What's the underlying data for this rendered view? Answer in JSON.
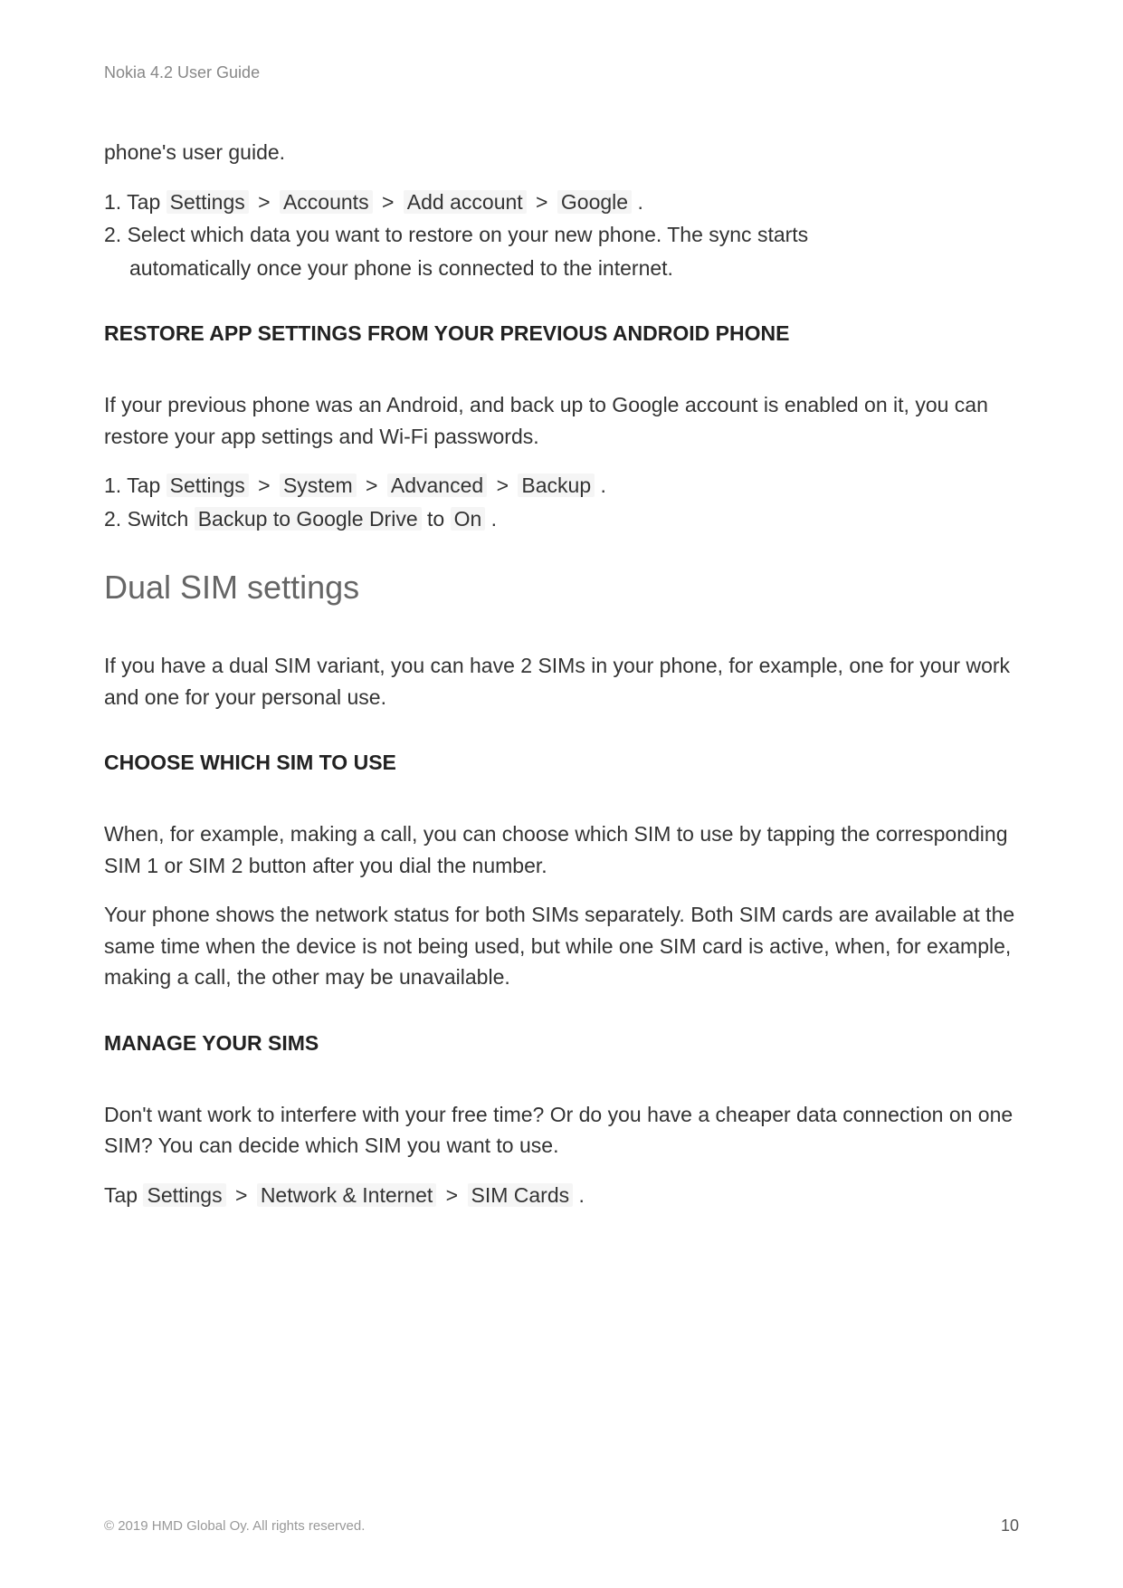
{
  "header": {
    "title": "Nokia 4.2 User Guide"
  },
  "intro": {
    "text": "phone's user guide."
  },
  "list1": {
    "item1_prefix": "1. Tap ",
    "item1_settings": "Settings",
    "item1_accounts": "Accounts",
    "item1_add_account": "Add account",
    "item1_google": "Google",
    "item1_suffix": " .",
    "item2_a": "2. Select which data you want to restore on your new phone. The sync starts",
    "item2_b": "automatically once your phone is connected to the internet."
  },
  "heading1": "RESTORE APP SETTINGS FROM YOUR PREVIOUS ANDROID PHONE",
  "para1": "If your previous phone was an Android, and back up to Google account is enabled on it, you can restore your app settings and Wi-Fi passwords.",
  "list2": {
    "item1_prefix": "1. Tap ",
    "item1_settings": "Settings",
    "item1_system": "System",
    "item1_advanced": "Advanced",
    "item1_backup": "Backup",
    "item1_suffix": " .",
    "item2_prefix": "2. Switch ",
    "item2_backup_drive": "Backup to Google Drive",
    "item2_to": " to ",
    "item2_on": "On",
    "item2_suffix": " ."
  },
  "heading2": "Dual SIM settings",
  "para2": "If you have a dual SIM variant, you can have 2 SIMs in your phone, for example, one for your work and one for your personal use.",
  "heading3": "CHOOSE WHICH SIM TO USE",
  "para3": "When, for example, making a call, you can choose which SIM to use by tapping the corresponding SIM 1 or SIM 2 button after you dial the number.",
  "para4": "Your phone shows the network status for both SIMs separately. Both SIM cards are available at the same time when the device is not being used, but while one SIM card is active, when, for example, making a call, the other may be unavailable.",
  "heading4": "MANAGE YOUR SIMS",
  "para5": "Don't want work to interfere with your free time? Or do you have a cheaper data connection on one SIM? You can decide which SIM you want to use.",
  "para6": {
    "prefix": "Tap ",
    "settings": "Settings",
    "network": "Network & Internet",
    "sim_cards": "SIM Cards",
    "suffix": " ."
  },
  "separator": " > ",
  "footer": {
    "copyright": "© 2019 HMD Global Oy. All rights reserved.",
    "page": "10"
  }
}
